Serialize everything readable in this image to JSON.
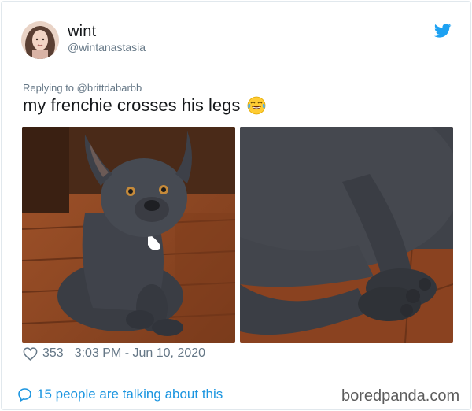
{
  "author": {
    "name": "wint",
    "handle": "@wintanastasia",
    "avatar_icon": "profile-photo"
  },
  "tweet": {
    "reply_line": "Replying to @brittdabarbb",
    "text": "my frenchie crosses his legs",
    "emoji_icon": "tears-of-joy-emoji",
    "photos": [
      {
        "alt_icon": "french-bulldog-sitting-photo"
      },
      {
        "alt_icon": "crossed-paws-closeup-photo"
      }
    ],
    "likes": "353",
    "time": "3:03 PM - Jun 10, 2020"
  },
  "footer": {
    "talking": "15 people are talking about this"
  },
  "watermark": "boredpanda.com",
  "colors": {
    "twitter_blue": "#1da1f2",
    "link_blue": "#1b95e0",
    "muted": "#657786",
    "border": "#e1e8ed"
  }
}
